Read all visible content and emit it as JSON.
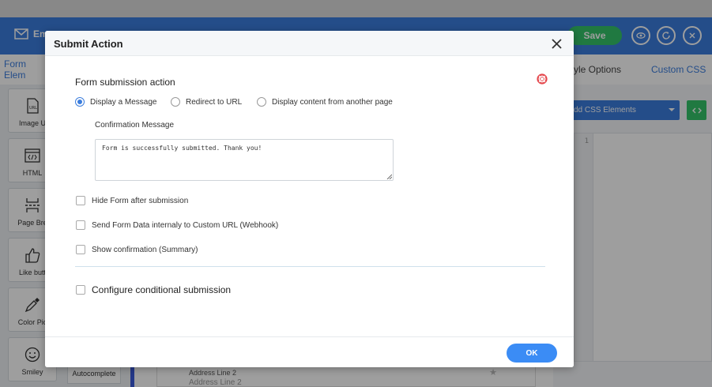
{
  "background": {
    "email_tab_label": "Em",
    "save_label": "Save",
    "left_tab": "Form Elem",
    "right_tabs": [
      "yle Options",
      "Custom CSS"
    ],
    "tools": [
      {
        "label": "Image U",
        "icon": "image-url-icon"
      },
      {
        "label": "HTML",
        "icon": "html-icon"
      },
      {
        "label": "Page Bre",
        "icon": "page-break-icon"
      },
      {
        "label": "Like butt",
        "icon": "thumbs-up-icon"
      },
      {
        "label": "Color Pic",
        "icon": "color-picker-icon"
      },
      {
        "label": "Smiley",
        "icon": "smiley-icon"
      }
    ],
    "autocomplete_label": "Autocomplete",
    "address_label": "Address Line 2",
    "address_placeholder": "Address Line 2",
    "add_css_label": "dd CSS Elements",
    "line_number": "1"
  },
  "modal": {
    "title": "Submit Action",
    "section_title": "Form submission action",
    "radio_options": [
      {
        "label": "Display a Message",
        "selected": true
      },
      {
        "label": "Redirect to URL",
        "selected": false
      },
      {
        "label": "Display content from another page",
        "selected": false
      }
    ],
    "confirmation_label": "Confirmation Message",
    "confirmation_value": "Form is successfully submitted. Thank you!",
    "checkboxes": [
      {
        "label": "Hide Form after submission",
        "checked": false
      },
      {
        "label": "Send Form Data internaly to Custom URL (Webhook)",
        "checked": false
      },
      {
        "label": "Show confirmation (Summary)",
        "checked": false
      }
    ],
    "conditional_label": "Configure conditional submission",
    "ok_label": "OK"
  },
  "colors": {
    "primary": "#3b7ddd",
    "save_green": "#35c46a",
    "ok_blue": "#3b8cf5",
    "help_red": "#e5484d"
  }
}
